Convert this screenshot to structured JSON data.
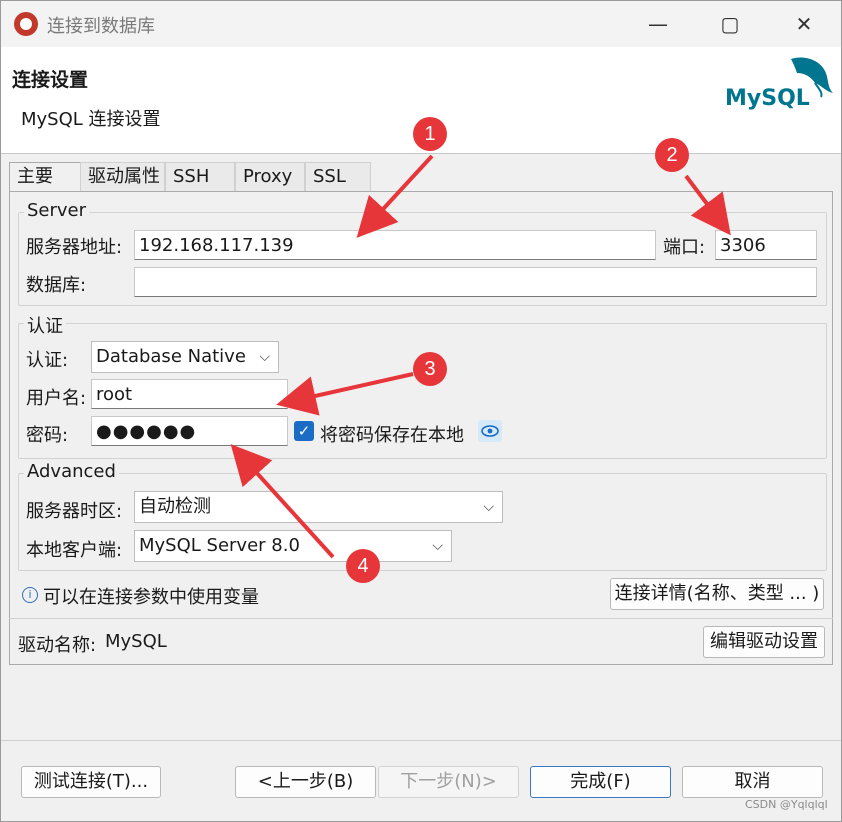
{
  "window": {
    "title": "连接到数据库"
  },
  "header": {
    "title": "连接设置",
    "subtitle": "MySQL 连接设置",
    "logo_text": "MySQL"
  },
  "tabs": [
    {
      "label": "主要",
      "active": true
    },
    {
      "label": "驱动属性",
      "active": false
    },
    {
      "label": "SSH",
      "active": false
    },
    {
      "label": "Proxy",
      "active": false
    },
    {
      "label": "SSL",
      "active": false
    }
  ],
  "server": {
    "group_label": "Server",
    "host_label": "服务器地址:",
    "host_value": "192.168.117.139",
    "port_label": "端口:",
    "port_value": "3306",
    "database_label": "数据库:",
    "database_value": ""
  },
  "auth": {
    "group_label": "认证",
    "auth_label": "认证:",
    "auth_value": "Database Native",
    "username_label": "用户名:",
    "username_value": "root",
    "password_label": "密码:",
    "password_value": "●●●●●●",
    "save_password_label": "将密码保存在本地",
    "save_password_checked": true
  },
  "advanced": {
    "group_label": "Advanced",
    "timezone_label": "服务器时区:",
    "timezone_value": "自动检测",
    "client_label": "本地客户端:",
    "client_value": "MySQL Server 8.0"
  },
  "info_text": "可以在连接参数中使用变量",
  "details_button": "连接详情(名称、类型 ... )",
  "driver": {
    "label": "驱动名称:",
    "value": "MySQL",
    "edit_button": "编辑驱动设置"
  },
  "footer": {
    "test": "测试连接(T)...",
    "back": "<上一步(B)",
    "next": "下一步(N)>",
    "finish": "完成(F)",
    "cancel": "取消"
  },
  "annotations": [
    "1",
    "2",
    "3",
    "4"
  ],
  "watermark": "CSDN @Yqlqlql",
  "colors": {
    "accent": "#1a6cc4",
    "marker": "#e7363a",
    "logo_blue": "#00758f",
    "logo_orange": "#f29111"
  }
}
